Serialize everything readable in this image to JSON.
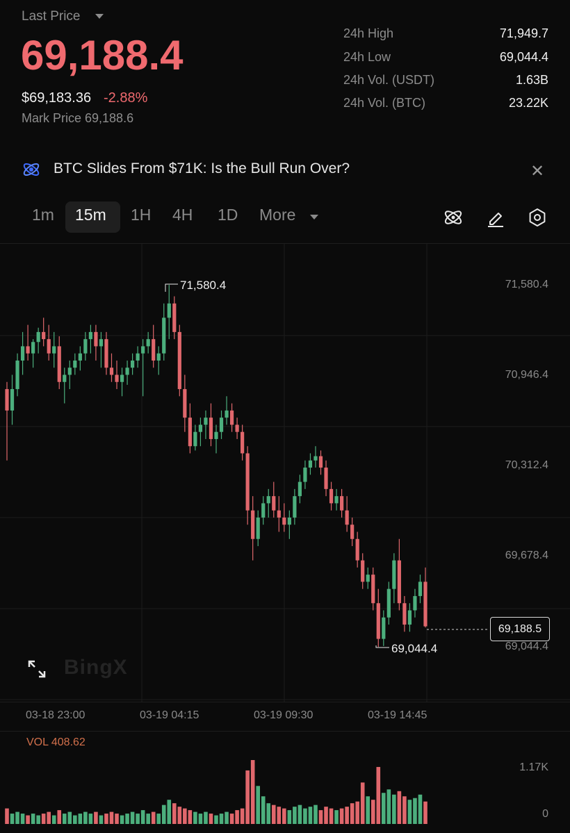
{
  "header": {
    "last_price_label": "Last Price",
    "last_price": "69,188.4",
    "usd_price": "$69,183.36",
    "change_pct": "-2.88%",
    "mark_price": "Mark Price 69,188.6",
    "stats": [
      {
        "label": "24h High",
        "value": "71,949.7"
      },
      {
        "label": "24h Low",
        "value": "69,044.4"
      },
      {
        "label": "24h Vol. (USDT)",
        "value": "1.63B"
      },
      {
        "label": "24h Vol. (BTC)",
        "value": "23.22K"
      }
    ]
  },
  "news": {
    "headline": "BTC Slides From $71K: Is the Bull Run Over?"
  },
  "timeframes": {
    "items": [
      "1m",
      "15m",
      "1H",
      "4H",
      "1D",
      "More"
    ],
    "active": "15m"
  },
  "chart": {
    "price_axis": [
      "71,580.4",
      "70,946.4",
      "70,312.4",
      "69,678.4",
      "69,044.4"
    ],
    "time_axis": [
      "03-18 23:00",
      "03-19 04:15",
      "03-19 09:30",
      "03-19 14:45"
    ],
    "high_label": "71,580.4",
    "low_label": "69,044.4",
    "current_price": "69,188.5",
    "watermark": "BingX"
  },
  "volume": {
    "label": "VOL 408.62",
    "axis_top": "1.17K",
    "axis_bottom": "0"
  },
  "colors": {
    "up": "#4caf7d",
    "down": "#e0676c",
    "accent": "#f06a6f"
  },
  "chart_data": {
    "type": "candlestick",
    "ylim": [
      68900,
      71750
    ],
    "candles": [
      [
        70850,
        70900,
        70350,
        70700
      ],
      [
        70700,
        70950,
        70600,
        70850
      ],
      [
        70850,
        71100,
        70800,
        71050
      ],
      [
        71050,
        71250,
        70950,
        71150
      ],
      [
        71150,
        71300,
        71050,
        71100
      ],
      [
        71100,
        71200,
        71000,
        71180
      ],
      [
        71180,
        71280,
        71100,
        71250
      ],
      [
        71250,
        71350,
        71150,
        71200
      ],
      [
        71200,
        71300,
        71050,
        71100
      ],
      [
        71100,
        71250,
        71000,
        71150
      ],
      [
        71150,
        71220,
        70850,
        70900
      ],
      [
        70900,
        71000,
        70750,
        70950
      ],
      [
        70950,
        71050,
        70850,
        71000
      ],
      [
        71000,
        71100,
        70950,
        71050
      ],
      [
        71050,
        71150,
        70980,
        71100
      ],
      [
        71100,
        71250,
        71050,
        71200
      ],
      [
        71200,
        71300,
        71100,
        71250
      ],
      [
        71250,
        71300,
        71050,
        71150
      ],
      [
        71150,
        71250,
        71000,
        71200
      ],
      [
        71200,
        71250,
        70950,
        71000
      ],
      [
        71000,
        71100,
        70900,
        70950
      ],
      [
        70950,
        71050,
        70850,
        70900
      ],
      [
        70900,
        71000,
        70800,
        70950
      ],
      [
        70950,
        71050,
        70880,
        71000
      ],
      [
        71000,
        71100,
        70950,
        71050
      ],
      [
        71050,
        71150,
        71000,
        71100
      ],
      [
        71100,
        71200,
        70800,
        71150
      ],
      [
        71150,
        71250,
        71100,
        71200
      ],
      [
        71200,
        71300,
        71000,
        71050
      ],
      [
        71050,
        71150,
        70950,
        71100
      ],
      [
        71100,
        71450,
        71050,
        71350
      ],
      [
        71350,
        71580,
        71200,
        71450
      ],
      [
        71450,
        71500,
        71200,
        71250
      ],
      [
        71250,
        71300,
        70800,
        70850
      ],
      [
        70850,
        70950,
        70550,
        70650
      ],
      [
        70650,
        70750,
        70400,
        70450
      ],
      [
        70450,
        70600,
        70420,
        70550
      ],
      [
        70550,
        70650,
        70450,
        70600
      ],
      [
        70600,
        70700,
        70500,
        70650
      ],
      [
        70650,
        70750,
        70450,
        70500
      ],
      [
        70500,
        70600,
        70400,
        70550
      ],
      [
        70550,
        70700,
        70500,
        70650
      ],
      [
        70650,
        70800,
        70600,
        70700
      ],
      [
        70700,
        70750,
        70550,
        70600
      ],
      [
        70600,
        70650,
        70500,
        70550
      ],
      [
        70550,
        70600,
        70350,
        70400
      ],
      [
        70400,
        70450,
        69900,
        70000
      ],
      [
        70000,
        70100,
        69650,
        69800
      ],
      [
        69800,
        70000,
        69750,
        69950
      ],
      [
        69950,
        70100,
        69900,
        70050
      ],
      [
        70050,
        70150,
        69950,
        70100
      ],
      [
        70100,
        70200,
        69950,
        70000
      ],
      [
        70000,
        70100,
        69850,
        69950
      ],
      [
        69950,
        70050,
        69850,
        69900
      ],
      [
        69900,
        70000,
        69800,
        69950
      ],
      [
        69950,
        70150,
        69900,
        70100
      ],
      [
        70100,
        70250,
        70050,
        70200
      ],
      [
        70200,
        70350,
        70150,
        70300
      ],
      [
        70300,
        70400,
        70250,
        70350
      ],
      [
        70350,
        70450,
        70300,
        70380
      ],
      [
        70380,
        70420,
        70250,
        70300
      ],
      [
        70300,
        70350,
        70100,
        70150
      ],
      [
        70150,
        70200,
        70000,
        70050
      ],
      [
        70050,
        70150,
        70000,
        70100
      ],
      [
        70100,
        70150,
        69950,
        70000
      ],
      [
        70000,
        70100,
        69850,
        69900
      ],
      [
        69900,
        69950,
        69750,
        69800
      ],
      [
        69800,
        69850,
        69600,
        69650
      ],
      [
        69650,
        69700,
        69450,
        69500
      ],
      [
        69500,
        69600,
        69450,
        69550
      ],
      [
        69550,
        69600,
        69300,
        69350
      ],
      [
        69350,
        69450,
        69044,
        69100
      ],
      [
        69100,
        69300,
        69050,
        69250
      ],
      [
        69250,
        69500,
        69200,
        69450
      ],
      [
        69450,
        69700,
        69350,
        69650
      ],
      [
        69650,
        69800,
        69300,
        69350
      ],
      [
        69350,
        69400,
        69150,
        69200
      ],
      [
        69200,
        69350,
        69150,
        69300
      ],
      [
        69300,
        69450,
        69250,
        69400
      ],
      [
        69400,
        69550,
        69350,
        69500
      ],
      [
        69500,
        69600,
        69180,
        69188
      ]
    ],
    "volumes": [
      0.09,
      0.06,
      0.07,
      0.06,
      0.05,
      0.06,
      0.05,
      0.06,
      0.07,
      0.05,
      0.08,
      0.06,
      0.07,
      0.05,
      0.06,
      0.07,
      0.06,
      0.07,
      0.05,
      0.06,
      0.07,
      0.06,
      0.05,
      0.06,
      0.07,
      0.06,
      0.08,
      0.06,
      0.07,
      0.06,
      0.11,
      0.14,
      0.12,
      0.1,
      0.09,
      0.08,
      0.07,
      0.06,
      0.07,
      0.06,
      0.05,
      0.06,
      0.07,
      0.06,
      0.08,
      0.09,
      0.31,
      0.37,
      0.22,
      0.16,
      0.12,
      0.11,
      0.1,
      0.09,
      0.08,
      0.1,
      0.11,
      0.09,
      0.1,
      0.11,
      0.08,
      0.1,
      0.09,
      0.08,
      0.09,
      0.1,
      0.12,
      0.13,
      0.24,
      0.16,
      0.14,
      0.33,
      0.18,
      0.2,
      0.17,
      0.19,
      0.16,
      0.14,
      0.15,
      0.17,
      0.13
    ]
  }
}
